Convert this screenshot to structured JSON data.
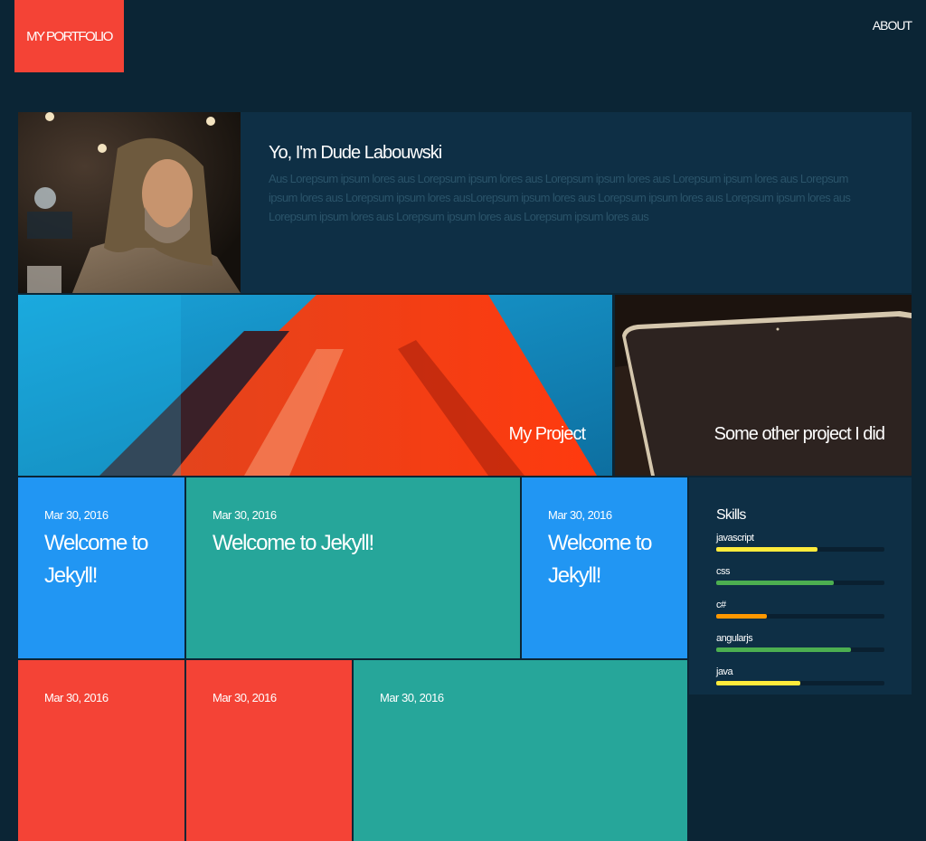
{
  "header": {
    "logo": "MY PORTFOLIO",
    "nav_about": "ABOUT"
  },
  "about": {
    "title": "Yo, I'm Dude Labouwski",
    "body": "Aus Lorepsum ipsum lores aus Lorepsum ipsum lores aus Lorepsum ipsum lores aus Lorepsum ipsum lores aus Lorepsum ipsum lores aus Lorepsum ipsum lores ausLorepsum ipsum lores aus Lorepsum ipsum lores aus Lorepsum ipsum lores aus Lorepsum ipsum lores aus Lorepsum ipsum lores aus Lorepsum ipsum lores aus"
  },
  "projects": [
    {
      "label": "My Project"
    },
    {
      "label": "Some other project I did"
    }
  ],
  "posts": [
    {
      "date": "Mar 30, 2016",
      "title": "Welcome to Jekyll!",
      "color": "#2196f3"
    },
    {
      "date": "Mar 30, 2016",
      "title": "Welcome to Jekyll!",
      "color": "#26a69a"
    },
    {
      "date": "Mar 30, 2016",
      "title": "Welcome to Jekyll!",
      "color": "#2196f3"
    },
    {
      "date": "Mar 30, 2016",
      "title": "",
      "color": "#f44336"
    },
    {
      "date": "Mar 30, 2016",
      "title": "",
      "color": "#f44336"
    },
    {
      "date": "Mar 30, 2016",
      "title": "",
      "color": "#26a69a"
    }
  ],
  "skills": {
    "title": "Skills",
    "items": [
      {
        "name": "javascript",
        "level": 0.6,
        "color": "#ffeb3b"
      },
      {
        "name": "css",
        "level": 0.7,
        "color": "#4caf50"
      },
      {
        "name": "c#",
        "level": 0.3,
        "color": "#ff9800"
      },
      {
        "name": "angularjs",
        "level": 0.8,
        "color": "#4caf50"
      },
      {
        "name": "java",
        "level": 0.5,
        "color": "#ffeb3b"
      }
    ]
  }
}
